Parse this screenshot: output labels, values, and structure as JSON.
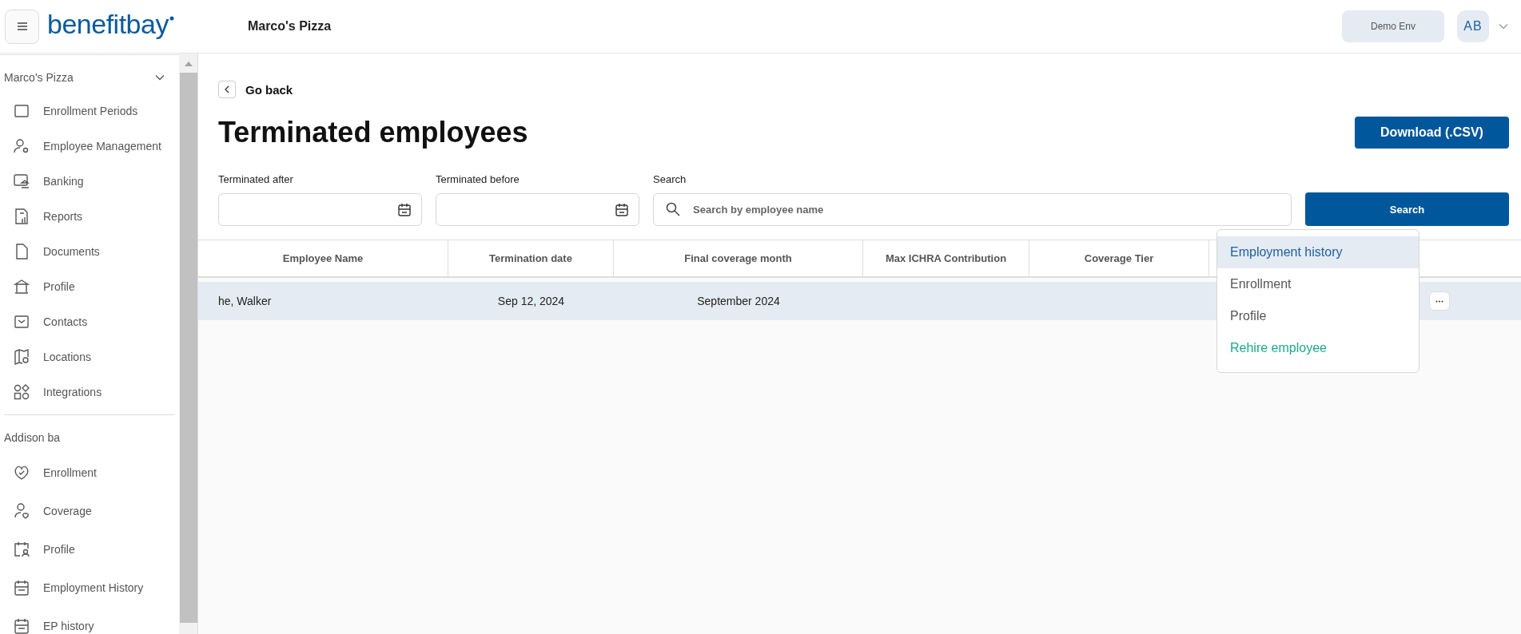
{
  "header": {
    "logo": "benefitbay",
    "company": "Marco's Pizza",
    "env_button": "Demo Env",
    "avatar": "AB"
  },
  "sidebar": {
    "groups": [
      {
        "title": "Marco's Pizza",
        "expanded": true,
        "items": [
          {
            "label": "Enrollment Periods"
          },
          {
            "label": "Employee Management"
          },
          {
            "label": "Banking"
          },
          {
            "label": "Reports"
          },
          {
            "label": "Documents"
          },
          {
            "label": "Profile"
          },
          {
            "label": "Contacts"
          },
          {
            "label": "Locations"
          },
          {
            "label": "Integrations"
          }
        ]
      },
      {
        "title": "Addison ba",
        "items": [
          {
            "label": "Enrollment"
          },
          {
            "label": "Coverage"
          },
          {
            "label": "Profile"
          },
          {
            "label": "Employment History"
          },
          {
            "label": "EP history"
          }
        ]
      }
    ]
  },
  "back": "Go back",
  "title": "Terminated employees",
  "download_button": "Download (.CSV)",
  "filters": [
    {
      "label": "Terminated after",
      "kind": "date"
    },
    {
      "label": "Terminated before",
      "kind": "date"
    },
    {
      "label": "Search",
      "kind": "search",
      "placeholder": "Search by employee name"
    }
  ],
  "search_button": "Search",
  "table": {
    "columns": [
      "Employee Name",
      "Termination date",
      "Final coverage month",
      "Max ICHRA Contribution",
      "Coverage Tier",
      ""
    ],
    "rows": [
      {
        "cells": [
          "he, Walker",
          "Sep 12, 2024",
          "September 2024",
          "",
          ""
        ],
        "selected": true
      }
    ]
  },
  "menu": {
    "items": [
      {
        "label": "Employment history",
        "selected": true,
        "kind": "item"
      },
      {
        "label": "Enrollment",
        "selected": false,
        "kind": "item"
      },
      {
        "label": "Profile",
        "selected": false,
        "kind": "item"
      },
      {
        "label": "Rehire employee",
        "selected": false,
        "kind": "action"
      }
    ]
  }
}
